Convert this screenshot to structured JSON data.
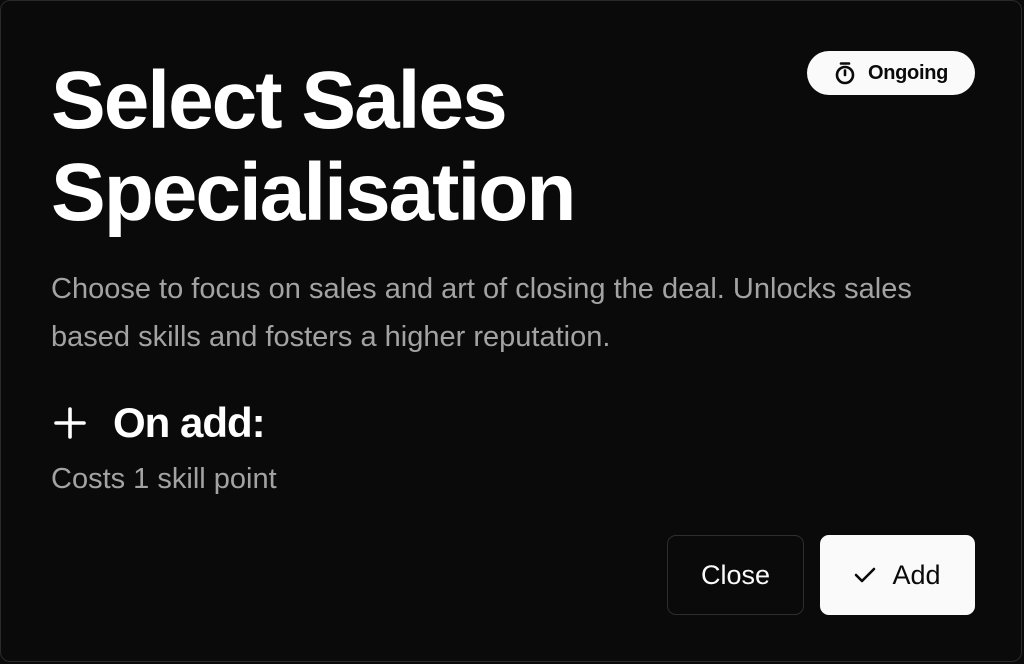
{
  "dialog": {
    "title": "Select Sales Specialisation",
    "badge": {
      "label": "Ongoing",
      "icon": "timer-icon"
    },
    "description": "Choose to focus on sales and art of closing the deal. Unlocks sales based skills and fosters a higher reputation.",
    "on_add": {
      "icon": "plus-icon",
      "label": "On add:"
    },
    "cost": "Costs 1 skill point",
    "buttons": {
      "close_label": "Close",
      "add_label": "Add",
      "add_icon": "check-icon"
    }
  },
  "colors": {
    "background": "#0a0a0a",
    "foreground": "#fafafa",
    "muted_text": "#a3a3a3",
    "border": "#2e2e2e"
  }
}
